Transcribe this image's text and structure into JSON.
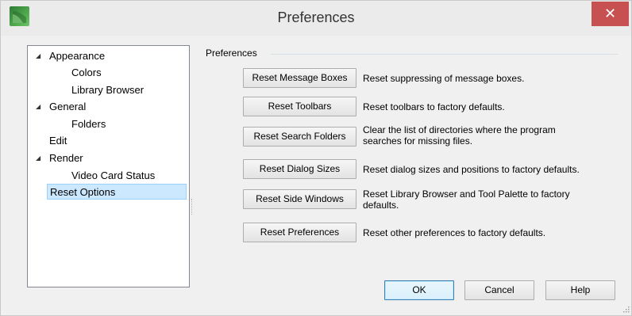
{
  "window": {
    "title": "Preferences",
    "close_glyph": "✕",
    "app_icon": "app-icon"
  },
  "tree": {
    "items": [
      {
        "label": "Appearance",
        "expanded": true
      },
      {
        "label": "Colors"
      },
      {
        "label": "Library Browser"
      },
      {
        "label": "General",
        "expanded": true
      },
      {
        "label": "Folders"
      },
      {
        "label": "Edit"
      },
      {
        "label": "Render",
        "expanded": true
      },
      {
        "label": "Video Card Status"
      },
      {
        "label": "Reset Options",
        "selected": true
      }
    ],
    "arrow_glyph": "◢"
  },
  "panel": {
    "group_title": "Preferences",
    "rows": [
      {
        "button": "Reset Message Boxes",
        "desc": "Reset suppressing of message boxes."
      },
      {
        "button": "Reset Toolbars",
        "desc": "Reset toolbars to factory defaults."
      },
      {
        "button": "Reset Search Folders",
        "desc_line1": "Clear the list of directories where the program",
        "desc_line2": "searches for missing files."
      },
      {
        "button": "Reset Dialog Sizes",
        "desc": "Reset dialog sizes and positions to factory defaults."
      },
      {
        "button": "Reset Side Windows",
        "desc_line1": "Reset Library Browser and Tool Palette to factory",
        "desc_line2": "defaults."
      },
      {
        "button": "Reset Preferences",
        "desc": "Reset other preferences to factory defaults."
      }
    ]
  },
  "footer": {
    "ok": "OK",
    "cancel": "Cancel",
    "help": "Help"
  },
  "colors": {
    "close": "#c75050",
    "selection": "#cce8ff",
    "accent": "#3c7fb1"
  }
}
